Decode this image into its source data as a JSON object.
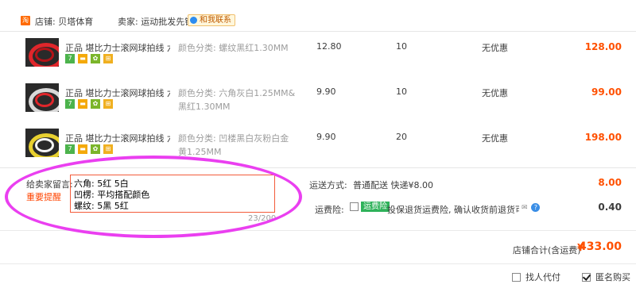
{
  "shop": {
    "logo_glyph": "淘",
    "shop_label": "店铺: 贝塔体育",
    "seller_label": "卖家: 运动批发先锋",
    "contact_label": "和我联系"
  },
  "items": [
    {
      "title": "正品 堪比力士滚网球拍线 六棱...",
      "sku": "颜色分类: 螺纹黑红1.30MM",
      "price": "12.80",
      "qty": "10",
      "promo": "无优惠",
      "subtotal": "128.00"
    },
    {
      "title": "正品 堪比力士滚网球拍线 六棱...",
      "sku": "颜色分类: 六角灰白1.25MM&黑红1.30MM",
      "price": "9.90",
      "qty": "10",
      "promo": "无优惠",
      "subtotal": "99.00"
    },
    {
      "title": "正品 堪比力士滚网球拍线 六棱...",
      "sku": "颜色分类: 凹楼黑白灰粉白金黄1.25MM",
      "price": "9.90",
      "qty": "20",
      "promo": "无优惠",
      "subtotal": "198.00"
    }
  ],
  "badges": {
    "seven": "7",
    "card": "▬",
    "leaf": "✿",
    "shield": "⊞"
  },
  "message": {
    "label": "给卖家留言:",
    "hint": "重要提醒",
    "line1": "六角: 5红 5白",
    "line2": "凹楞: 平均搭配颜色",
    "line3": "螺纹: 5黑 5红",
    "count": "23/200"
  },
  "shipping": {
    "label": "运送方式:",
    "value": "普通配送 快递¥8.00",
    "fee": "8.00"
  },
  "insurance": {
    "label": "运费险:",
    "tag": "运费险",
    "desc": "投保退货运费险, 确认收货前退货可赔...",
    "fee": "0.40",
    "chat_glyph": "✉",
    "help_glyph": "?"
  },
  "total": {
    "label": "店铺合计(含运费)",
    "currency": "¥",
    "value": "433.00"
  },
  "options": {
    "proxy_pay": "找人代付",
    "anonymous": "匿名购买"
  },
  "colors": {
    "accent": "#ff5000",
    "annotation": "#ea3ff0",
    "coil1": "#e0262b",
    "coil2": "#d9d9d9",
    "coil3": "#e8d030"
  }
}
